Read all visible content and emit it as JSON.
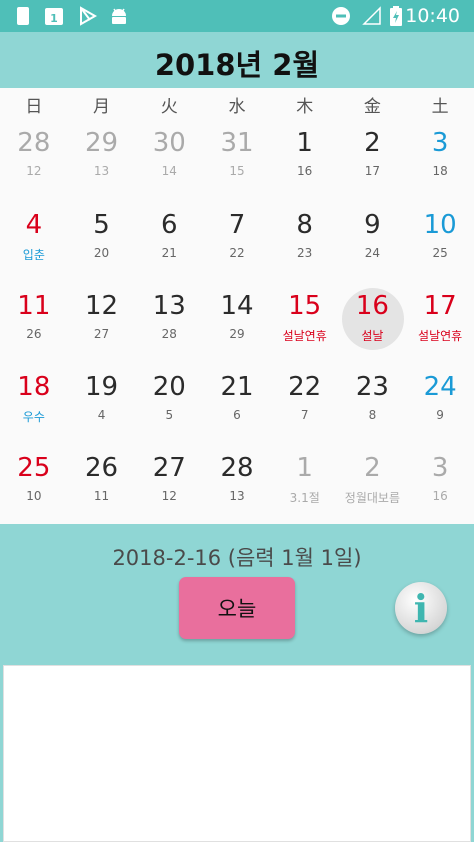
{
  "status_bar": {
    "time": "10:40",
    "icons": [
      "sim-card-icon",
      "calendar-app-icon",
      "play-store-icon",
      "android-icon",
      "do-not-disturb-icon",
      "signal-icon",
      "battery-charging-icon"
    ]
  },
  "header": {
    "title": "2018년 2월"
  },
  "weekdays": [
    "日",
    "月",
    "火",
    "水",
    "木",
    "金",
    "土"
  ],
  "weeks": [
    [
      {
        "day": "28",
        "sub": "12",
        "other": true
      },
      {
        "day": "29",
        "sub": "13",
        "other": true
      },
      {
        "day": "30",
        "sub": "14",
        "other": true
      },
      {
        "day": "31",
        "sub": "15",
        "other": true
      },
      {
        "day": "1",
        "sub": "16"
      },
      {
        "day": "2",
        "sub": "17"
      },
      {
        "day": "3",
        "sub": "18"
      }
    ],
    [
      {
        "day": "4",
        "sub": "입춘",
        "sub_color": "blue"
      },
      {
        "day": "5",
        "sub": "20"
      },
      {
        "day": "6",
        "sub": "21"
      },
      {
        "day": "7",
        "sub": "22"
      },
      {
        "day": "8",
        "sub": "23"
      },
      {
        "day": "9",
        "sub": "24"
      },
      {
        "day": "10",
        "sub": "25"
      }
    ],
    [
      {
        "day": "11",
        "sub": "26"
      },
      {
        "day": "12",
        "sub": "27"
      },
      {
        "day": "13",
        "sub": "28"
      },
      {
        "day": "14",
        "sub": "29"
      },
      {
        "day": "15",
        "sub": "설날연휴",
        "holiday": true,
        "sub_color": "red"
      },
      {
        "day": "16",
        "sub": "설날",
        "holiday": true,
        "sub_color": "red",
        "selected": true
      },
      {
        "day": "17",
        "sub": "설날연휴",
        "holiday": true,
        "sub_color": "red"
      }
    ],
    [
      {
        "day": "18",
        "sub": "우수",
        "sub_color": "blue"
      },
      {
        "day": "19",
        "sub": "4"
      },
      {
        "day": "20",
        "sub": "5"
      },
      {
        "day": "21",
        "sub": "6"
      },
      {
        "day": "22",
        "sub": "7"
      },
      {
        "day": "23",
        "sub": "8"
      },
      {
        "day": "24",
        "sub": "9"
      }
    ],
    [
      {
        "day": "25",
        "sub": "10"
      },
      {
        "day": "26",
        "sub": "11"
      },
      {
        "day": "27",
        "sub": "12"
      },
      {
        "day": "28",
        "sub": "13"
      },
      {
        "day": "1",
        "sub": "3.1절",
        "other": true
      },
      {
        "day": "2",
        "sub": "정월대보름",
        "other": true
      },
      {
        "day": "3",
        "sub": "16",
        "other": true
      }
    ]
  ],
  "date_info": "2018-2-16  (음력 1월 1일)",
  "today_button": "오늘",
  "info_button": "i",
  "colors": {
    "status_bar": "#4fbfb8",
    "header": "#8fd6d4",
    "sunday": "#d9001b",
    "saturday": "#1a9ad6",
    "today_button": "#e96f9d"
  }
}
